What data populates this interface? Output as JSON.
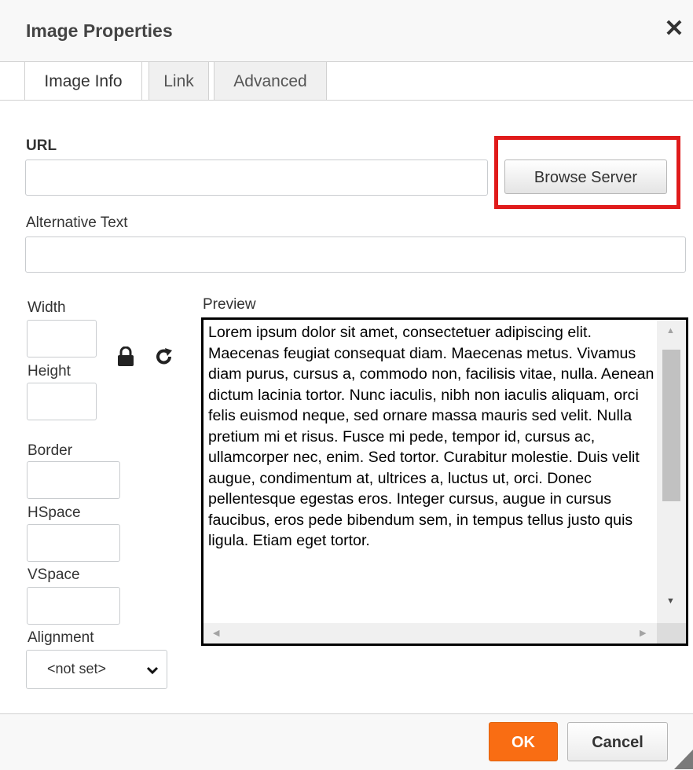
{
  "dialog": {
    "title": "Image Properties",
    "close_glyph": "✕"
  },
  "tabs": [
    {
      "label": "Image Info",
      "active": true
    },
    {
      "label": "Link",
      "active": false
    },
    {
      "label": "Advanced",
      "active": false
    }
  ],
  "url": {
    "label": "URL",
    "value": ""
  },
  "browse_button": {
    "label": "Browse Server"
  },
  "alt_text": {
    "label": "Alternative Text",
    "value": ""
  },
  "dimensions": {
    "width_label": "Width",
    "height_label": "Height",
    "lock_icon": "lock-icon",
    "reset_icon": "reset-size-icon"
  },
  "border": {
    "label": "Border"
  },
  "hspace": {
    "label": "HSpace"
  },
  "vspace": {
    "label": "VSpace"
  },
  "alignment": {
    "label": "Alignment",
    "value": "<not set>"
  },
  "preview": {
    "label": "Preview",
    "text": "Lorem ipsum dolor sit amet, consectetuer adipiscing elit. Maecenas feugiat consequat diam. Maecenas metus. Vivamus diam purus, cursus a, commodo non, facilisis vitae, nulla. Aenean dictum lacinia tortor. Nunc iaculis, nibh non iaculis aliquam, orci felis euismod neque, sed ornare massa mauris sed velit. Nulla pretium mi et risus. Fusce mi pede, tempor id, cursus ac, ullamcorper nec, enim. Sed tortor. Curabitur molestie. Duis velit augue, condimentum at, ultrices a, luctus ut, orci. Donec pellentesque egestas eros. Integer cursus, augue in cursus faucibus, eros pede bibendum sem, in tempus tellus justo quis ligula. Etiam eget tortor."
  },
  "footer": {
    "ok_label": "OK",
    "cancel_label": "Cancel"
  },
  "colors": {
    "ok": "#f96d13",
    "highlight": "#e01b1b"
  }
}
